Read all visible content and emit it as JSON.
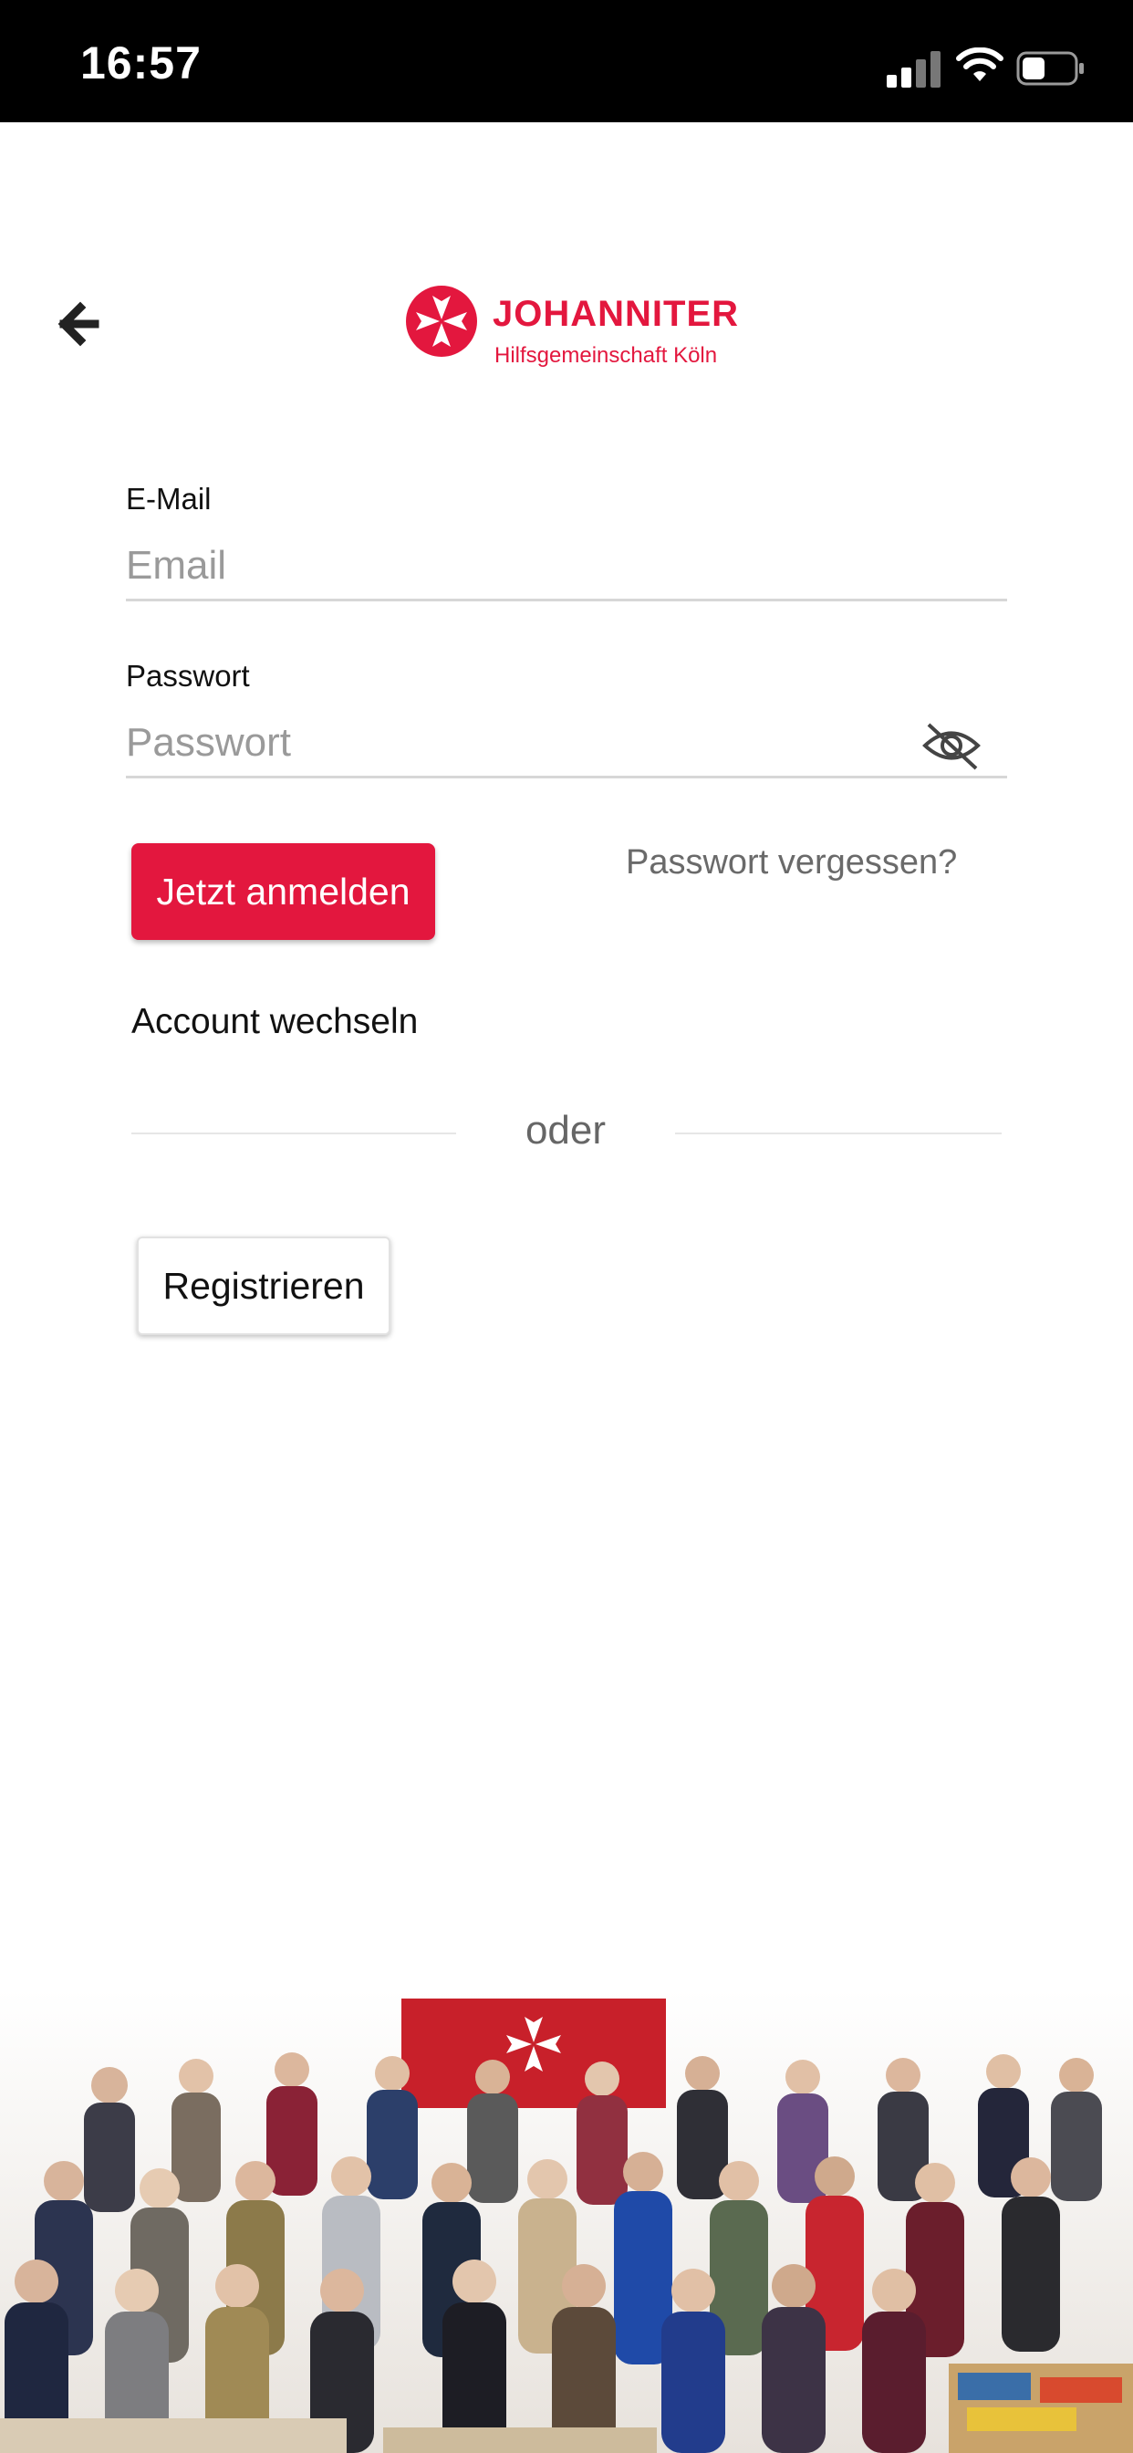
{
  "status_bar": {
    "time": "16:57",
    "icons": [
      "cellular-signal-icon",
      "wifi-icon",
      "battery-icon"
    ]
  },
  "header": {
    "back_icon": "arrow-left-icon",
    "logo_title": "JOHANNITER",
    "logo_subtitle": "Hilfsgemeinschaft Köln"
  },
  "form": {
    "email_label": "E-Mail",
    "email_placeholder": "Email",
    "email_value": "",
    "password_label": "Passwort",
    "password_placeholder": "Passwort",
    "password_value": "",
    "visibility_icon": "eye-off-icon"
  },
  "actions": {
    "login_label": "Jetzt anmelden",
    "forgot_label": "Passwort vergessen?",
    "switch_account_label": "Account wechseln",
    "divider_label": "oder",
    "register_label": "Registrieren"
  },
  "colors": {
    "brand_red": "#e3173e",
    "status_bar": "#000000",
    "background": "#ffffff"
  }
}
